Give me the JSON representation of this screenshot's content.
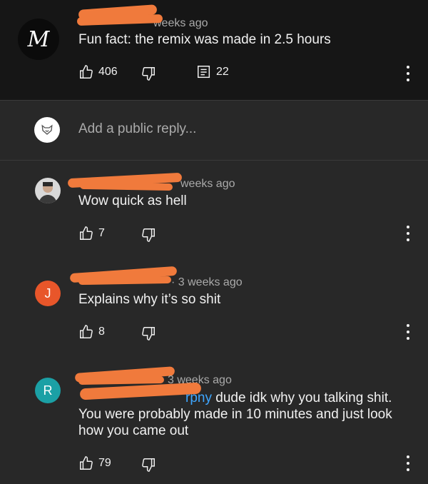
{
  "comments": [
    {
      "avatar_text": "M",
      "meta_suffix": "weeks ago",
      "text": "Fun fact: the remix was made in 2.5 hours",
      "likes": "406",
      "replies": "22"
    },
    {
      "meta_suffix": "weeks ago",
      "text": "Wow quick as hell",
      "likes": "7"
    },
    {
      "avatar_letter": "J",
      "meta_suffix": "· 3 weeks ago",
      "text": "Explains why it’s so shit",
      "likes": "8"
    },
    {
      "avatar_letter": "R",
      "meta_suffix": "3 weeks ago",
      "mention": "rpny",
      "text_after_mention": " dude idk why you talking shit.",
      "text_rest": "You were probably made in 10 minutes and just look how you came out",
      "likes": "79"
    }
  ],
  "reply_box": {
    "placeholder": "Add a public reply..."
  },
  "colors": {
    "redaction": "#f07a3c",
    "avatar_j": "#e8562a",
    "avatar_r": "#1ba0a5",
    "link": "#3ea6ff"
  }
}
